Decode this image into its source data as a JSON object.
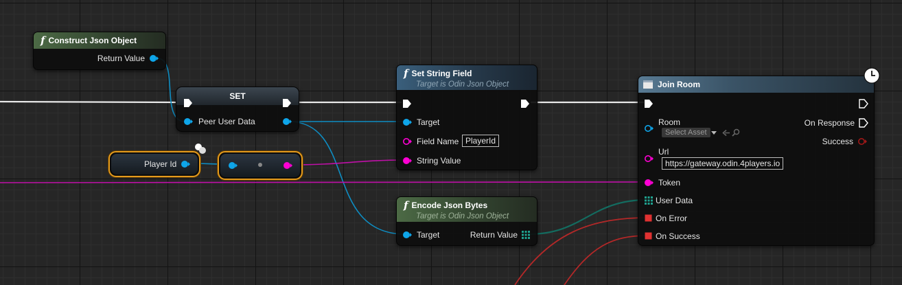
{
  "graph": {
    "nodes": {
      "construct_json_object": {
        "title": "Construct Json Object",
        "return_value_label": "Return Value"
      },
      "set": {
        "title": "SET",
        "peer_user_data_label": "Peer User Data"
      },
      "player_id_var": {
        "label": "Player Id"
      },
      "set_string_field": {
        "title": "Set String Field",
        "subtitle": "Target is Odin Json Object",
        "target_label": "Target",
        "field_name_label": "Field Name",
        "field_name_value": "PlayerId",
        "string_value_label": "String Value"
      },
      "encode_json_bytes": {
        "title": "Encode Json Bytes",
        "subtitle": "Target is Odin Json Object",
        "target_label": "Target",
        "return_value_label": "Return Value"
      },
      "join_room": {
        "title": "Join Room",
        "room_label": "Room",
        "room_select_placeholder": "Select Asset",
        "url_label": "Url",
        "url_value": "https://gateway.odin.4players.io",
        "token_label": "Token",
        "user_data_label": "User Data",
        "on_error_label": "On Error",
        "on_success_label": "On Success",
        "on_response_label": "On Response",
        "success_label": "Success"
      }
    },
    "colors": {
      "exec": "#ffffff",
      "object": "#0ea5e9",
      "string": "#ff00d4",
      "bytes": "#1e7a6e",
      "delegate": "#e03131",
      "variable_outline": "#e39a1d"
    },
    "icons": {
      "function": "function-f-icon",
      "latent": "clock-icon",
      "event": "event-node-icon",
      "array": "array-grid-icon"
    }
  }
}
